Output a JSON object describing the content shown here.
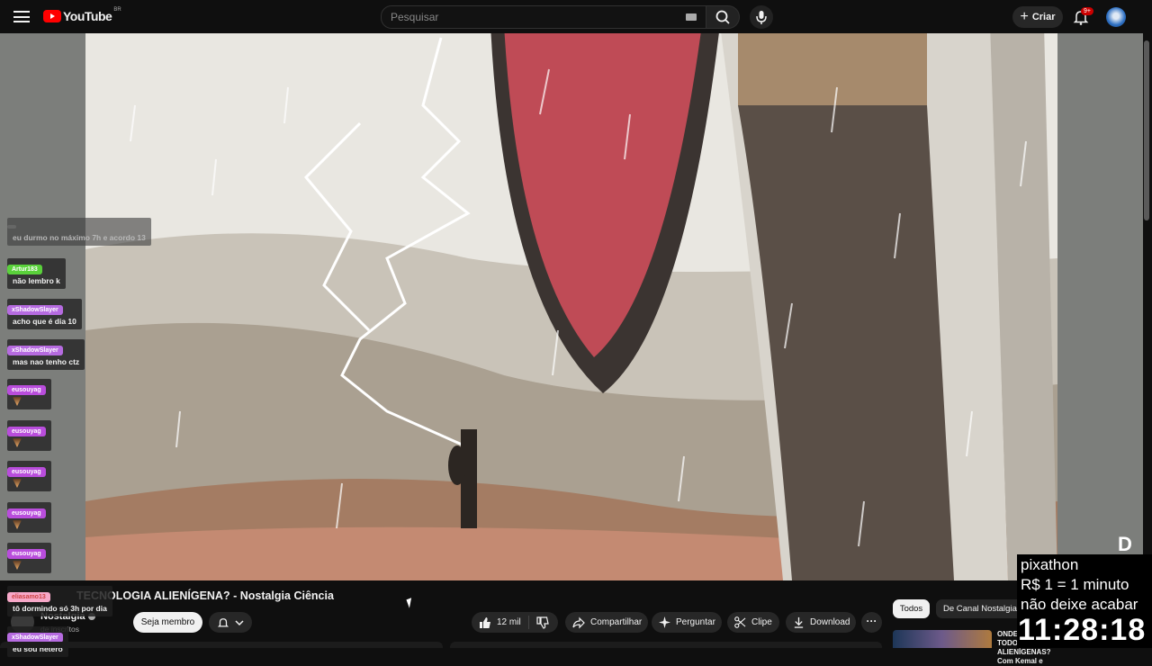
{
  "header": {
    "logo_text": "YouTube",
    "logo_country": "BR",
    "search_placeholder": "Pesquisar",
    "create_label": "Criar",
    "notifications_badge": "9+"
  },
  "chat": [
    {
      "user": "",
      "text": "eu durmo no máximo 7h e acordo 13",
      "color": "#9e9e9e"
    },
    {
      "user": "Artur183",
      "text": "não lembro k",
      "color": "#5ad13b"
    },
    {
      "user": "xShadowSlayer",
      "text": "acho que é dia 10",
      "color": "#b66be0"
    },
    {
      "user": "xShadowSlayer",
      "text": "mas nao tenho ctz",
      "color": "#b66be0"
    },
    {
      "user": "eusouyag",
      "text": "",
      "color": "#b94ddc",
      "emote": true
    },
    {
      "user": "eusouyag",
      "text": "",
      "color": "#b94ddc",
      "emote": true
    },
    {
      "user": "eusouyag",
      "text": "",
      "color": "#b94ddc",
      "emote": true
    },
    {
      "user": "eusouyag",
      "text": "",
      "color": "#b94ddc",
      "emote": true
    },
    {
      "user": "eusouyag",
      "text": "",
      "color": "#b94ddc",
      "emote": true
    },
    {
      "user": "eliasamo13",
      "text": "tô dormindo só 3h por dia",
      "color": "#f7a8c8"
    },
    {
      "user": "xShadowSlayer",
      "text": "eu sou hetero",
      "color": "#b66be0"
    }
  ],
  "video": {
    "title": "TECNOLOGIA ALIENÍGENA? - Nostalgia Ciência",
    "channel": "Nostalgia",
    "subscribers": "de inscritos",
    "member_label": "Seja membro",
    "likes": "12 mil",
    "share_label": "Compartilhar",
    "ask_label": "Perguntar",
    "clip_label": "Clipe",
    "download_label": "Download"
  },
  "sidebar": {
    "chips": [
      "Todos",
      "De Canal Nostalgia"
    ],
    "rec_title": "ONDE ESTÃO TODOS ALIENÍGENAS? Com Kemal e"
  },
  "overlay": {
    "line1": "pixathon",
    "line2": "R$ 1 = 1 minuto",
    "line3": "não deixe acabar",
    "timer": "11:28:18"
  }
}
